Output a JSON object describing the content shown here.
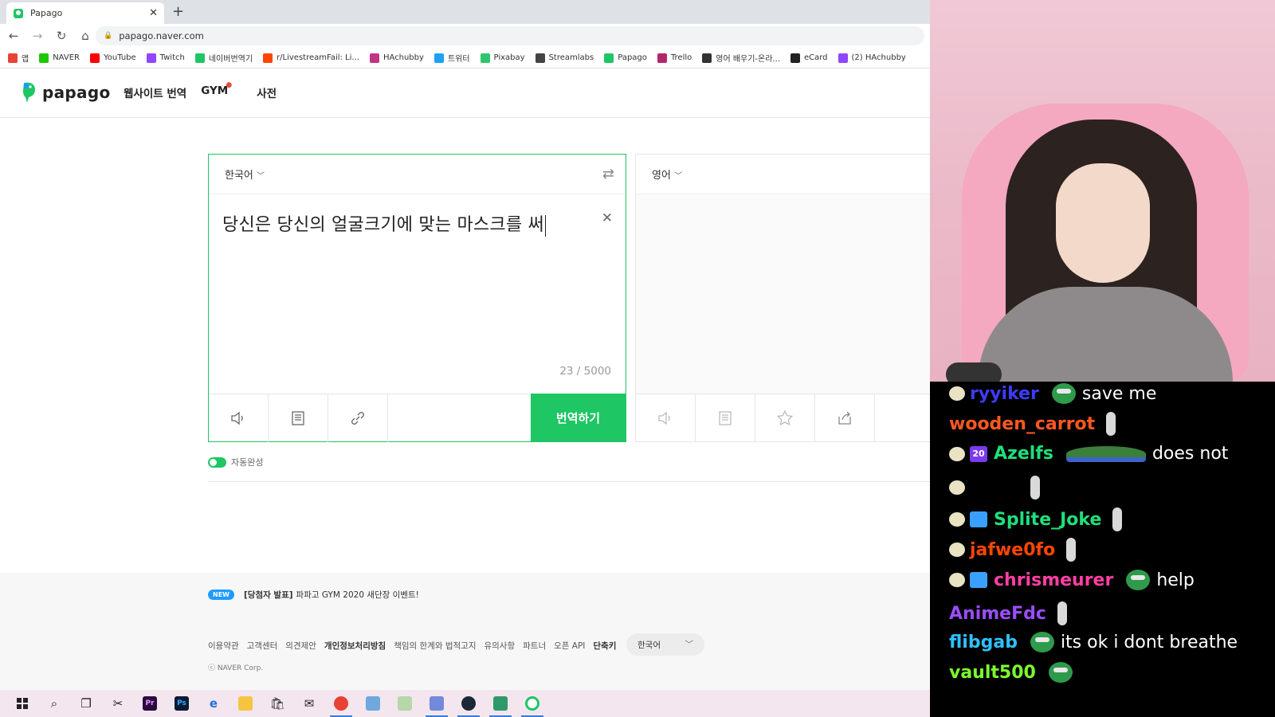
{
  "browser": {
    "tab_title": "Papago",
    "url": "papago.naver.com",
    "bookmarks": [
      {
        "label": "앱",
        "color": "#e94235"
      },
      {
        "label": "NAVER",
        "color": "#1ec800"
      },
      {
        "label": "YouTube",
        "color": "#ff0000"
      },
      {
        "label": "Twitch",
        "color": "#9146ff"
      },
      {
        "label": "네이버번역기",
        "color": "#1ec664"
      },
      {
        "label": "r/LivestreamFail: Li...",
        "color": "#ff4500"
      },
      {
        "label": "HAchubby",
        "color": "#c13584"
      },
      {
        "label": "트위터",
        "color": "#1da1f2"
      },
      {
        "label": "Pixabay",
        "color": "#2ec66d"
      },
      {
        "label": "Streamlabs",
        "color": "#444444"
      },
      {
        "label": "Papago",
        "color": "#1ec664"
      },
      {
        "label": "Trello",
        "color": "#b0276b"
      },
      {
        "label": "영어 배우기-온라...",
        "color": "#333333"
      },
      {
        "label": "eCard",
        "color": "#222222"
      },
      {
        "label": "(2) HAchubby",
        "color": "#9146ff"
      }
    ]
  },
  "papago": {
    "logo_text": "papago",
    "nav": [
      "웹사이트 번역",
      "GYM",
      "사전"
    ],
    "source_lang": "한국어",
    "target_lang": "영어",
    "source_text": "당신은 당신의 얼굴크기에 맞는 마스크를 써",
    "counter": "23 / 5000",
    "translate_label": "번역하기",
    "autocomplete_label": "자동완성",
    "notice": {
      "badge": "NEW",
      "bold": "[당첨자 발표]",
      "text": "파파고 GYM 2020 새단장 이벤트!"
    },
    "footer_links": [
      "이용약관",
      "고객센터",
      "의견제안",
      "개인정보처리방침",
      "책임의 한계와 법적고지",
      "유의사항",
      "파트너",
      "오픈 API",
      "단축키"
    ],
    "footer_lang": "한국어",
    "copyright": "ⓒ NAVER Corp."
  },
  "chat": [
    {
      "name": "ryyiker",
      "color": "#3c3cff",
      "text": "save me",
      "badges": [
        "mod"
      ],
      "emote": true
    },
    {
      "name": "wooden_carrot",
      "color": "#ff5722",
      "text": "",
      "ghost": true
    },
    {
      "name": "Azelfs",
      "color": "#1ee07c",
      "text": "does not",
      "badges": [
        "mod",
        "sub20"
      ],
      "wide_emote": true
    },
    {
      "name": "",
      "color": "#ffffff",
      "text": "",
      "badges": [
        "mod"
      ],
      "ghost": true
    },
    {
      "name": "Splite_Joke",
      "color": "#1ee07c",
      "text": "",
      "badges": [
        "mod",
        "crown"
      ],
      "ghost": true
    },
    {
      "name": "jafwe0fo",
      "color": "#ff4500",
      "text": "",
      "badges": [
        "mod"
      ],
      "ghost": true
    },
    {
      "name": "chrismeurer",
      "color": "#ff3fa4",
      "text": "help",
      "badges": [
        "mod",
        "crown"
      ],
      "emote": true
    },
    {
      "name": "AnimeFdc",
      "color": "#9b4dff",
      "text": "",
      "ghost": true
    },
    {
      "name": "flibgab",
      "color": "#2ec0ff",
      "text": "its ok i dont breathe",
      "emote": true
    },
    {
      "name": "vault500",
      "color": "#7cff2e",
      "text": "",
      "emote": true
    }
  ]
}
